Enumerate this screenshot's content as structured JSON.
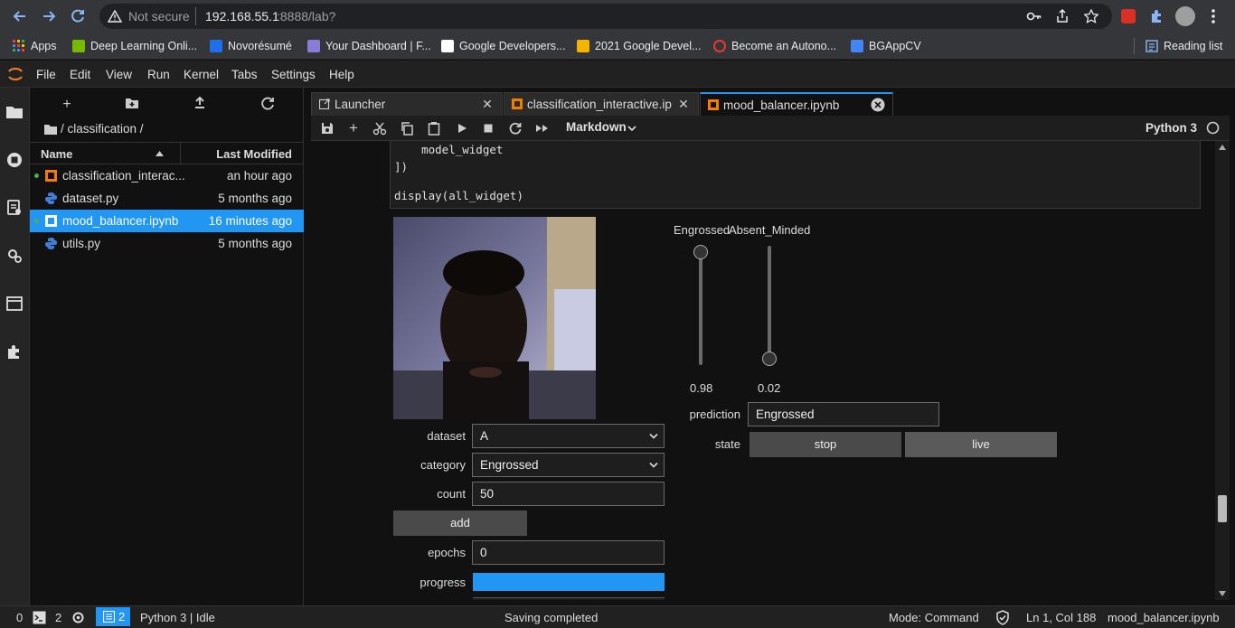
{
  "browser": {
    "security": "Not secure",
    "url_host": "192.168.55.1",
    "url_rest": ":8888/lab?",
    "bookmarks": [
      {
        "label": "Apps",
        "color": "#e8eaed"
      },
      {
        "label": "Deep Learning Onli...",
        "color": "#76b900"
      },
      {
        "label": "Novorésumé",
        "color": "#1f6feb"
      },
      {
        "label": "Your Dashboard | F...",
        "color": "#8a7bd8"
      },
      {
        "label": "Google Developers...",
        "color": "#ffffff"
      },
      {
        "label": "2021 Google Devel...",
        "color": "#f4b400"
      },
      {
        "label": "Become an Autono...",
        "color": "#e53935"
      },
      {
        "label": "BGAppCV",
        "color": "#4285f4"
      }
    ],
    "reading_list": "Reading list"
  },
  "menu": [
    "File",
    "Edit",
    "View",
    "Run",
    "Kernel",
    "Tabs",
    "Settings",
    "Help"
  ],
  "filebrowser": {
    "breadcrumb": "/ classification /",
    "col_name": "Name",
    "col_modified": "Last Modified",
    "files": [
      {
        "name": "classification_interac...",
        "modified": "an hour ago",
        "type": "notebook",
        "running": true
      },
      {
        "name": "dataset.py",
        "modified": "5 months ago",
        "type": "python",
        "running": false
      },
      {
        "name": "mood_balancer.ipynb",
        "modified": "16 minutes ago",
        "type": "notebook",
        "running": true,
        "selected": true
      },
      {
        "name": "utils.py",
        "modified": "5 months ago",
        "type": "python",
        "running": false
      }
    ]
  },
  "tabs": [
    {
      "label": "Launcher",
      "type": "launcher"
    },
    {
      "label": "classification_interactive.ipyn",
      "type": "notebook"
    },
    {
      "label": "mood_balancer.ipynb",
      "type": "notebook",
      "active": true
    }
  ],
  "toolbar": {
    "cell_type": "Markdown",
    "kernel": "Python 3"
  },
  "code": [
    "    model_widget",
    "])",
    "",
    "display(all_widget)"
  ],
  "widgets": {
    "dataset_label": "dataset",
    "dataset_value": "A",
    "category_label": "category",
    "category_value": "Engrossed",
    "count_label": "count",
    "count_value": "50",
    "add_label": "add",
    "epochs_label": "epochs",
    "epochs_value": "0",
    "progress_label": "progress",
    "progress_value": 1.0,
    "slider1_label": "Engrossed",
    "slider1_value": "0.98",
    "slider1_level": 0.98,
    "slider2_label": "Absent_Minded",
    "slider2_value": "0.02",
    "slider2_level": 0.02,
    "prediction_label": "prediction",
    "prediction_value": "Engrossed",
    "state_label": "state",
    "stop_label": "stop",
    "live_label": "live"
  },
  "status": {
    "terminals": "0",
    "kernels": "2",
    "cells": "2",
    "kernel_state": "Python 3 | Idle",
    "message": "Saving completed",
    "mode": "Mode: Command",
    "position": "Ln 1, Col 188",
    "file": "mood_balancer.ipynb"
  },
  "colors": {
    "accent": "#2196f3",
    "notebook_icon": "#f57c00",
    "python_icon": "#3f7fd6",
    "running_dot": "#4caf50"
  }
}
